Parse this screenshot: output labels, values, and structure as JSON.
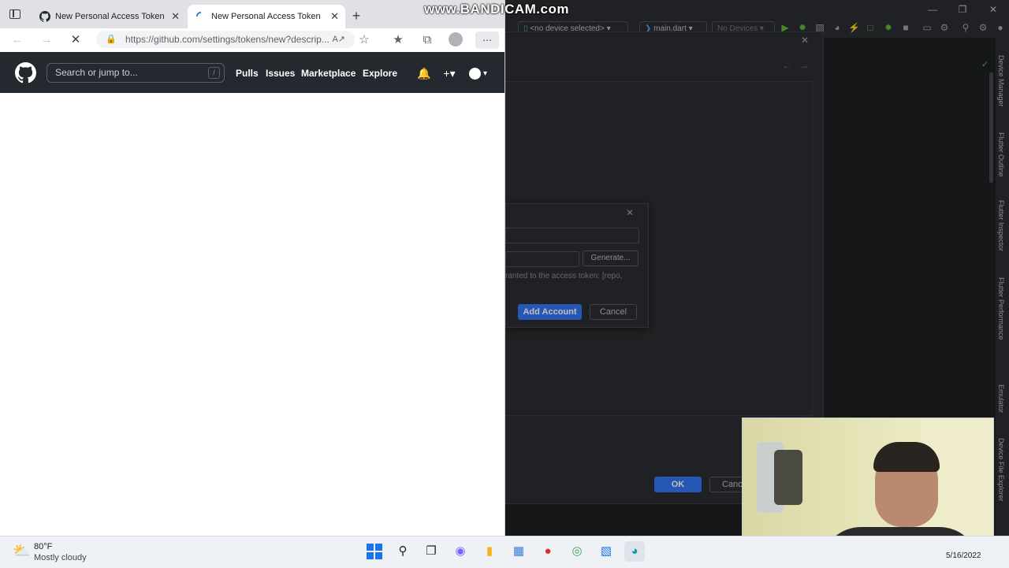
{
  "watermark": "www.BANDICAM.com",
  "browser": {
    "tabs": [
      {
        "label": "New Personal Access Token",
        "active": false
      },
      {
        "label": "New Personal Access Token",
        "active": true
      }
    ],
    "new_tab": "+",
    "url": "https://github.com/settings/tokens/new?descrip..."
  },
  "github": {
    "search_placeholder": "Search or jump to...",
    "search_key": "/",
    "nav": [
      "Pulls",
      "Issues",
      "Marketplace",
      "Explore"
    ]
  },
  "ide": {
    "device_selector": "<no device selected>",
    "run_config": "main.dart",
    "devices": "No Devices",
    "side_tabs": [
      "Device Manager",
      "Flutter Outline",
      "Flutter Inspector",
      "Flutter Performance",
      "Emulator",
      "Device File Explorer"
    ],
    "settings_ok": "OK",
    "settings_cancel": "Cance",
    "add_account": {
      "generate": "Generate...",
      "hint": "ranted to the access token: [repo,",
      "add_button": "Add Account",
      "cancel_button": "Cancel"
    }
  },
  "taskbar": {
    "temperature": "80°F",
    "weather": "Mostly cloudy",
    "date": "5/16/2022"
  },
  "colors": {
    "github_header": "#24292f",
    "ide_bg": "#2b2d30",
    "primary_button": "#3574f0"
  }
}
